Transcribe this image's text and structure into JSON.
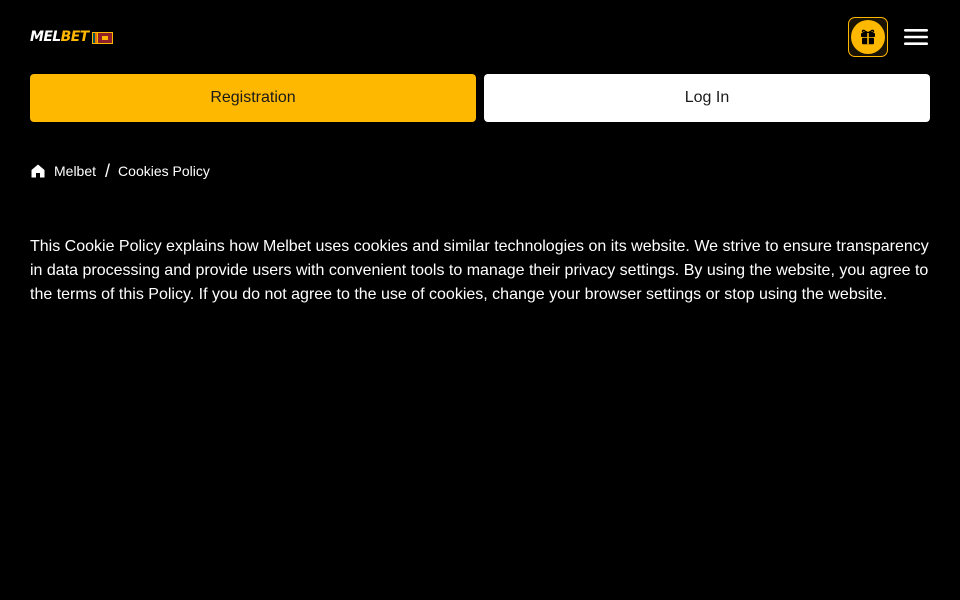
{
  "header": {
    "logo": {
      "part1": "MEL",
      "part2": "BET"
    },
    "icons": {
      "gift": "gift-icon",
      "menu": "hamburger-menu-icon",
      "flag": "sri-lanka-flag-icon"
    }
  },
  "auth": {
    "register_label": "Registration",
    "login_label": "Log In"
  },
  "breadcrumb": {
    "home_label": "Melbet",
    "separator": "/",
    "current": "Cookies Policy"
  },
  "content": {
    "paragraph": "This Cookie Policy explains how Melbet uses cookies and similar technologies on its website. We strive to ensure transparency in data processing and provide users with convenient tools to manage their privacy settings. By using the website, you agree to the terms of this Policy. If you do not agree to the use of cookies, change your browser settings or stop using the website."
  },
  "colors": {
    "background": "#000000",
    "accent": "#ffb800",
    "text": "#ffffff"
  }
}
